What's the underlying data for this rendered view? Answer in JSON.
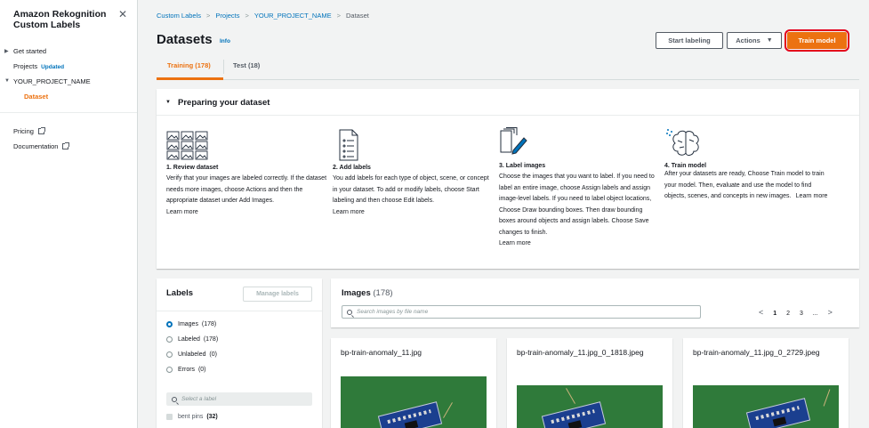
{
  "sidebar": {
    "title": "Amazon Rekognition Custom Labels",
    "items": [
      {
        "label": "Get started"
      },
      {
        "label": "Projects",
        "badge": "Updated"
      },
      {
        "label": "YOUR_PROJECT_NAME"
      },
      {
        "label": "Dataset"
      }
    ],
    "links": [
      {
        "label": "Pricing"
      },
      {
        "label": "Documentation"
      }
    ]
  },
  "breadcrumb": [
    "Custom Labels",
    "Projects",
    "YOUR_PROJECT_NAME",
    "Dataset"
  ],
  "header": {
    "title": "Datasets",
    "info": "Info",
    "start_labeling": "Start labeling",
    "actions": "Actions",
    "train_model": "Train model"
  },
  "tabs": [
    {
      "label": "Training (178)"
    },
    {
      "label": "Test (18)"
    }
  ],
  "prep": {
    "title": "Preparing your dataset",
    "steps": [
      {
        "title": "1. Review dataset",
        "text": "Verify that your images are labeled correctly. If the dataset needs more images, choose Actions and then the appropriate dataset under Add Images.",
        "link": "Learn more",
        "icon": "images-grid-icon"
      },
      {
        "title": "2. Add labels",
        "text": "You add labels for each type of object, scene, or concept in your dataset. To add or modify labels, choose Start labeling and then choose Edit labels.",
        "link": "Learn more",
        "icon": "document-list-icon"
      },
      {
        "title": "3. Label images",
        "text": "Choose the images that you want to label. If you need to label an entire image, choose Assign labels and assign image-level labels. If you need to label object locations, Choose Draw bounding boxes. Then draw bounding boxes around objects and assign labels. Choose Save changes to finish.",
        "link": "Learn more",
        "icon": "pencil-stack-icon"
      },
      {
        "title": "4. Train model",
        "text": "After your datasets are ready, Choose Train model to train your model. Then, evaluate and use the model to find objects, scenes, and concepts in new images.",
        "link": "Learn more",
        "icon": "brain-icon"
      }
    ]
  },
  "labels": {
    "title": "Labels",
    "manage": "Manage labels",
    "filters": [
      {
        "label": "Images",
        "count": "(178)"
      },
      {
        "label": "Labeled",
        "count": "(178)"
      },
      {
        "label": "Unlabeled",
        "count": "(0)"
      },
      {
        "label": "Errors",
        "count": "(0)"
      }
    ],
    "search_placeholder": "Select a label",
    "label_items": [
      {
        "label": "bent pins",
        "count": "(32)"
      }
    ]
  },
  "images": {
    "title": "Images",
    "count": "(178)",
    "search_placeholder": "Search images by file name",
    "pages": [
      "1",
      "2",
      "3",
      "..."
    ],
    "cards": [
      {
        "name": "bp-train-anomaly_11.jpg"
      },
      {
        "name": "bp-train-anomaly_11.jpg_0_1818.jpeg"
      },
      {
        "name": "bp-train-anomaly_11.jpg_0_2729.jpeg"
      }
    ]
  },
  "colors": {
    "accent": "#ec7211",
    "link": "#0073bb",
    "highlight": "#e4001b"
  }
}
